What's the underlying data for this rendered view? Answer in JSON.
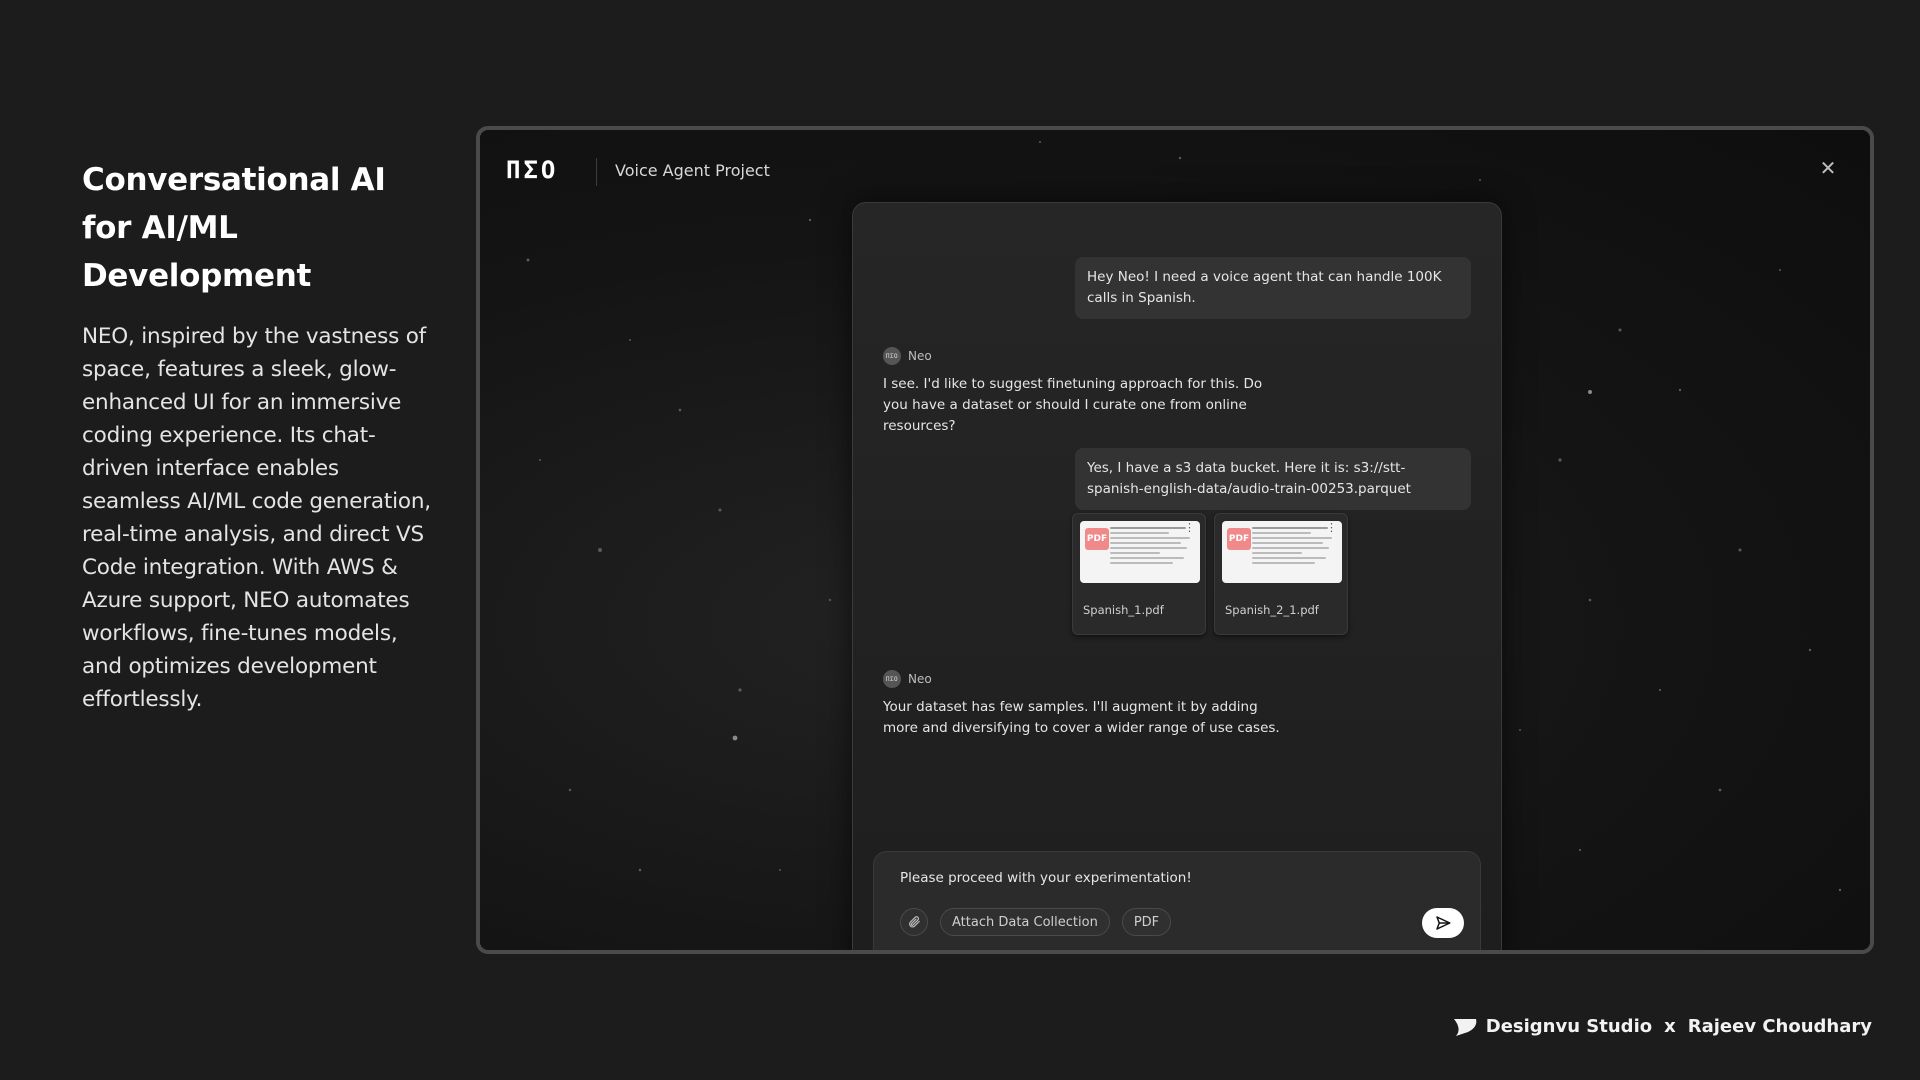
{
  "intro": {
    "heading": "Conversational AI for AI/ML Development",
    "body": "NEO, inspired by the vastness of space, features a sleek, glow-enhanced UI for an immersive coding experience. Its chat-driven interface enables seamless AI/ML code generation, real-time analysis, and direct VS Code integration. With AWS & Azure support, NEO automates workflows, fine-tunes models, and optimizes development effortlessly."
  },
  "app": {
    "logo": "ΠΣΟ",
    "project_title": "Voice Agent Project",
    "close_icon": "close-icon"
  },
  "chat": {
    "messages": [
      {
        "role": "user",
        "text": "Hey Neo! I need a voice agent that can handle 100K calls in Spanish."
      },
      {
        "role": "agent",
        "name": "Neo",
        "avatar": "ΠΣΟ",
        "text": "I see. I'd like to suggest finetuning approach for this. Do you have a dataset or should I curate one from online resources?"
      },
      {
        "role": "user",
        "text": "Yes, I have a s3 data bucket. Here it is: s3://stt-spanish-english-data/audio-train-00253.parquet"
      },
      {
        "role": "agent",
        "name": "Neo",
        "avatar": "ΠΣΟ",
        "text": "Your dataset has few samples. I'll augment it by adding more and diversifying to cover a wider range of use cases."
      }
    ],
    "attachments": [
      {
        "name": "Spanish_1.pdf",
        "badge": "PDF"
      },
      {
        "name": "Spanish_2_1.pdf",
        "badge": "PDF"
      }
    ],
    "composer": {
      "text": "Please proceed with your experimentation!",
      "attach_chip": "Attach Data Collection",
      "pdf_chip": "PDF"
    }
  },
  "credit": {
    "studio": "Designvu Studio",
    "separator": "x",
    "author": "Rajeev Choudhary"
  }
}
